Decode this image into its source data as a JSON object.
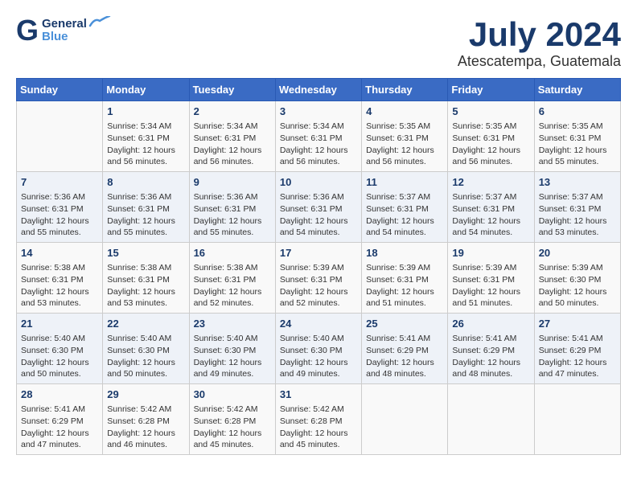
{
  "header": {
    "logo_general": "General",
    "logo_blue": "Blue",
    "month_year": "July 2024",
    "location": "Atescatempa, Guatemala"
  },
  "weekdays": [
    "Sunday",
    "Monday",
    "Tuesday",
    "Wednesday",
    "Thursday",
    "Friday",
    "Saturday"
  ],
  "weeks": [
    [
      {
        "day": "",
        "info": ""
      },
      {
        "day": "1",
        "info": "Sunrise: 5:34 AM\nSunset: 6:31 PM\nDaylight: 12 hours\nand 56 minutes."
      },
      {
        "day": "2",
        "info": "Sunrise: 5:34 AM\nSunset: 6:31 PM\nDaylight: 12 hours\nand 56 minutes."
      },
      {
        "day": "3",
        "info": "Sunrise: 5:34 AM\nSunset: 6:31 PM\nDaylight: 12 hours\nand 56 minutes."
      },
      {
        "day": "4",
        "info": "Sunrise: 5:35 AM\nSunset: 6:31 PM\nDaylight: 12 hours\nand 56 minutes."
      },
      {
        "day": "5",
        "info": "Sunrise: 5:35 AM\nSunset: 6:31 PM\nDaylight: 12 hours\nand 56 minutes."
      },
      {
        "day": "6",
        "info": "Sunrise: 5:35 AM\nSunset: 6:31 PM\nDaylight: 12 hours\nand 55 minutes."
      }
    ],
    [
      {
        "day": "7",
        "info": "Sunrise: 5:36 AM\nSunset: 6:31 PM\nDaylight: 12 hours\nand 55 minutes."
      },
      {
        "day": "8",
        "info": "Sunrise: 5:36 AM\nSunset: 6:31 PM\nDaylight: 12 hours\nand 55 minutes."
      },
      {
        "day": "9",
        "info": "Sunrise: 5:36 AM\nSunset: 6:31 PM\nDaylight: 12 hours\nand 55 minutes."
      },
      {
        "day": "10",
        "info": "Sunrise: 5:36 AM\nSunset: 6:31 PM\nDaylight: 12 hours\nand 54 minutes."
      },
      {
        "day": "11",
        "info": "Sunrise: 5:37 AM\nSunset: 6:31 PM\nDaylight: 12 hours\nand 54 minutes."
      },
      {
        "day": "12",
        "info": "Sunrise: 5:37 AM\nSunset: 6:31 PM\nDaylight: 12 hours\nand 54 minutes."
      },
      {
        "day": "13",
        "info": "Sunrise: 5:37 AM\nSunset: 6:31 PM\nDaylight: 12 hours\nand 53 minutes."
      }
    ],
    [
      {
        "day": "14",
        "info": "Sunrise: 5:38 AM\nSunset: 6:31 PM\nDaylight: 12 hours\nand 53 minutes."
      },
      {
        "day": "15",
        "info": "Sunrise: 5:38 AM\nSunset: 6:31 PM\nDaylight: 12 hours\nand 53 minutes."
      },
      {
        "day": "16",
        "info": "Sunrise: 5:38 AM\nSunset: 6:31 PM\nDaylight: 12 hours\nand 52 minutes."
      },
      {
        "day": "17",
        "info": "Sunrise: 5:39 AM\nSunset: 6:31 PM\nDaylight: 12 hours\nand 52 minutes."
      },
      {
        "day": "18",
        "info": "Sunrise: 5:39 AM\nSunset: 6:31 PM\nDaylight: 12 hours\nand 51 minutes."
      },
      {
        "day": "19",
        "info": "Sunrise: 5:39 AM\nSunset: 6:31 PM\nDaylight: 12 hours\nand 51 minutes."
      },
      {
        "day": "20",
        "info": "Sunrise: 5:39 AM\nSunset: 6:30 PM\nDaylight: 12 hours\nand 50 minutes."
      }
    ],
    [
      {
        "day": "21",
        "info": "Sunrise: 5:40 AM\nSunset: 6:30 PM\nDaylight: 12 hours\nand 50 minutes."
      },
      {
        "day": "22",
        "info": "Sunrise: 5:40 AM\nSunset: 6:30 PM\nDaylight: 12 hours\nand 50 minutes."
      },
      {
        "day": "23",
        "info": "Sunrise: 5:40 AM\nSunset: 6:30 PM\nDaylight: 12 hours\nand 49 minutes."
      },
      {
        "day": "24",
        "info": "Sunrise: 5:40 AM\nSunset: 6:30 PM\nDaylight: 12 hours\nand 49 minutes."
      },
      {
        "day": "25",
        "info": "Sunrise: 5:41 AM\nSunset: 6:29 PM\nDaylight: 12 hours\nand 48 minutes."
      },
      {
        "day": "26",
        "info": "Sunrise: 5:41 AM\nSunset: 6:29 PM\nDaylight: 12 hours\nand 48 minutes."
      },
      {
        "day": "27",
        "info": "Sunrise: 5:41 AM\nSunset: 6:29 PM\nDaylight: 12 hours\nand 47 minutes."
      }
    ],
    [
      {
        "day": "28",
        "info": "Sunrise: 5:41 AM\nSunset: 6:29 PM\nDaylight: 12 hours\nand 47 minutes."
      },
      {
        "day": "29",
        "info": "Sunrise: 5:42 AM\nSunset: 6:28 PM\nDaylight: 12 hours\nand 46 minutes."
      },
      {
        "day": "30",
        "info": "Sunrise: 5:42 AM\nSunset: 6:28 PM\nDaylight: 12 hours\nand 45 minutes."
      },
      {
        "day": "31",
        "info": "Sunrise: 5:42 AM\nSunset: 6:28 PM\nDaylight: 12 hours\nand 45 minutes."
      },
      {
        "day": "",
        "info": ""
      },
      {
        "day": "",
        "info": ""
      },
      {
        "day": "",
        "info": ""
      }
    ]
  ]
}
